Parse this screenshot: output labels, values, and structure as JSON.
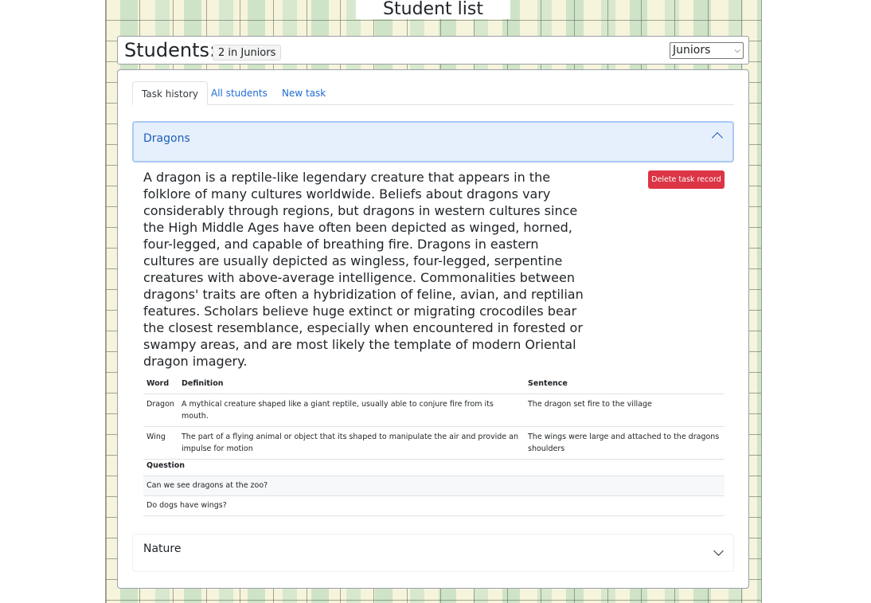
{
  "page": {
    "title": "Student list"
  },
  "students": {
    "heading": "Students:",
    "badge": "2 in Juniors",
    "group_select": {
      "selected": "Juniors"
    }
  },
  "tabs": [
    {
      "label": "Task history",
      "active": true
    },
    {
      "label": "All students",
      "active": false
    },
    {
      "label": "New task",
      "active": false
    }
  ],
  "tasks": [
    {
      "title": "Dragons",
      "expanded": true,
      "delete_label": "Delete task record",
      "passage": "A dragon is a reptile-like legendary creature that appears in the folklore of many cultures worldwide. Beliefs about dragons vary considerably through regions, but dragons in western cultures since the High Middle Ages have often been depicted as winged, horned, four-legged, and capable of breathing fire. Dragons in eastern cultures are usually depicted as wingless, four-legged, serpentine creatures with above-average intelligence. Commonalities between dragons' traits are often a hybridization of feline, avian, and reptilian features. Scholars believe huge extinct or migrating crocodiles bear the closest resemblance, especially when encountered in forested or swampy areas, and are most likely the template of modern Oriental dragon imagery.",
      "word_table": {
        "headers": [
          "Word",
          "Definition",
          "Sentence"
        ],
        "rows": [
          [
            "Dragon",
            "A mythical creature shaped like a giant reptile, usually able to conjure fire from its mouth.",
            "The dragon set fire to the village"
          ],
          [
            "Wing",
            "The part of a flying animal or object that its shaped to manipulate the air and provide an impulse for motion",
            "The wings were large and attached to the dragons shoulders"
          ]
        ]
      },
      "question_table": {
        "header": "Question",
        "rows": [
          "Can we see dragons at the zoo?",
          "Do dogs have wings?"
        ]
      }
    },
    {
      "title": "Nature",
      "expanded": false
    }
  ],
  "colors": {
    "accent": "#1e6bd6",
    "danger": "#dc3545",
    "accordion_active_bg": "#e6f0fd"
  }
}
